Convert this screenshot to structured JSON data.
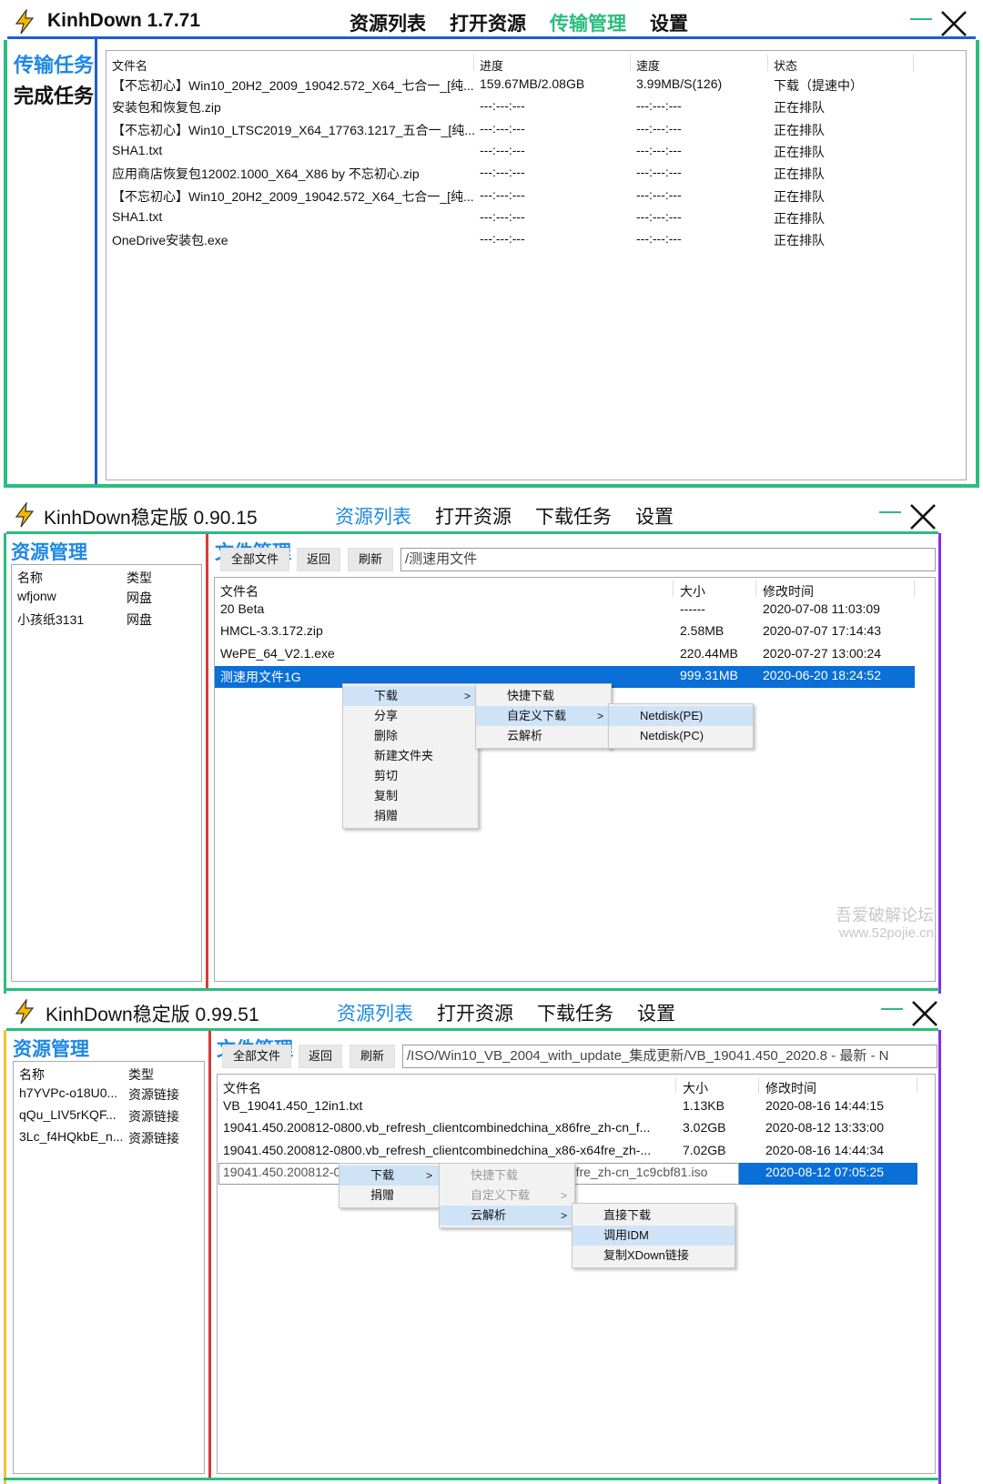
{
  "colors": {
    "green": "#2bbd7e",
    "blue": "#1e5fd0",
    "red": "#d93a3a",
    "purple": "#8a2be2",
    "yellow": "#f2c12e",
    "accent": "#1e88e5",
    "selected": "#0a6fd6"
  },
  "p1": {
    "title": "KinhDown 1.7.71",
    "nav": [
      "资源列表",
      "打开资源",
      "传输管理",
      "设置"
    ],
    "sidebar": [
      "传输任务",
      "完成任务"
    ],
    "columns": [
      "文件名",
      "进度",
      "速度",
      "状态"
    ],
    "rows": [
      [
        "【不忘初心】Win10_20H2_2009_19042.572_X64_七合一_[纯...",
        "159.67MB/2.08GB",
        "3.99MB/S(126)",
        "下载（提速中）"
      ],
      [
        "安装包和恢复包.zip",
        "---:---:---",
        "---:---:---",
        "正在排队"
      ],
      [
        "【不忘初心】Win10_LTSC2019_X64_17763.1217_五合一_[纯...",
        "---:---:---",
        "---:---:---",
        "正在排队"
      ],
      [
        "SHA1.txt",
        "---:---:---",
        "---:---:---",
        "正在排队"
      ],
      [
        "应用商店恢复包12002.1000_X64_X86 by 不忘初心.zip",
        "---:---:---",
        "---:---:---",
        "正在排队"
      ],
      [
        "【不忘初心】Win10_20H2_2009_19042.572_X64_七合一_[纯...",
        "---:---:---",
        "---:---:---",
        "正在排队"
      ],
      [
        "SHA1.txt",
        "---:---:---",
        "---:---:---",
        "正在排队"
      ],
      [
        "OneDrive安装包.exe",
        "---:---:---",
        "---:---:---",
        "正在排队"
      ]
    ]
  },
  "p2": {
    "title": "KinhDown稳定版 0.90.15",
    "nav": [
      "资源列表",
      "打开资源",
      "下载任务",
      "设置"
    ],
    "left_title": "资源管理",
    "left_columns": [
      "名称",
      "类型"
    ],
    "left_rows": [
      [
        "wfjonw",
        "网盘"
      ],
      [
        "小孩纸3131",
        "网盘"
      ]
    ],
    "right_title": "文件管理",
    "toolbar": [
      "全部文件",
      "返回",
      "刷新"
    ],
    "path": "/测速用文件",
    "columns": [
      "文件名",
      "大小",
      "修改时间"
    ],
    "rows": [
      [
        "20 Beta",
        "------",
        "2020-07-08 11:03:09"
      ],
      [
        "HMCL-3.3.172.zip",
        "2.58MB",
        "2020-07-07 17:14:43"
      ],
      [
        "WePE_64_V2.1.exe",
        "220.44MB",
        "2020-07-27 13:00:24"
      ],
      [
        "测速用文件1G",
        "999.31MB",
        "2020-06-20 18:24:52"
      ]
    ],
    "menu1": [
      "下载",
      "分享",
      "删除",
      "新建文件夹",
      "剪切",
      "复制",
      "捐赠"
    ],
    "menu2": [
      "快捷下载",
      "自定义下载",
      "云解析"
    ],
    "menu3": [
      "Netdisk(PE)",
      "Netdisk(PC)"
    ],
    "arrow": ">",
    "watermark": [
      "吾爱破解论坛",
      "www.52pojie.cn"
    ]
  },
  "p3": {
    "title": "KinhDown稳定版 0.99.51",
    "nav": [
      "资源列表",
      "打开资源",
      "下载任务",
      "设置"
    ],
    "left_title": "资源管理",
    "left_columns": [
      "名称",
      "类型"
    ],
    "left_rows": [
      [
        "h7YVPc-o18U0...",
        "资源链接"
      ],
      [
        "qQu_LIV5rKQF...",
        "资源链接"
      ],
      [
        "3Lc_f4HQkbE_n...",
        "资源链接"
      ]
    ],
    "right_title": "文件管理",
    "toolbar": [
      "全部文件",
      "返回",
      "刷新"
    ],
    "path": "/ISO/Win10_VB_2004_with_update_集成更新/VB_19041.450_2020.8 - 最新 - N",
    "columns": [
      "文件名",
      "大小",
      "修改时间"
    ],
    "rows": [
      [
        "VB_19041.450_12in1.txt",
        "1.13KB",
        "2020-08-16 14:44:15"
      ],
      [
        "19041.450.200812-0800.vb_refresh_clientcombinedchina_x86fre_zh-cn_f...",
        "3.02GB",
        "2020-08-12 13:33:00"
      ],
      [
        "19041.450.200812-0800.vb_refresh_clientcombinedchina_x86-x64fre_zh-...",
        "7.02GB",
        "2020-08-16 14:44:34"
      ],
      [
        "19041.450.200812-0800.vb_refresh_clientcombinedchina_x64fre_zh-cn_1c9cbf81.iso",
        "",
        "2020-08-12 07:05:25"
      ]
    ],
    "menu1": [
      "下载",
      "捐赠"
    ],
    "menu2": [
      "快捷下载",
      "自定义下载",
      "云解析"
    ],
    "menu3": [
      "直接下载",
      "调用IDM",
      "复制XDown链接"
    ],
    "arrow": ">"
  }
}
